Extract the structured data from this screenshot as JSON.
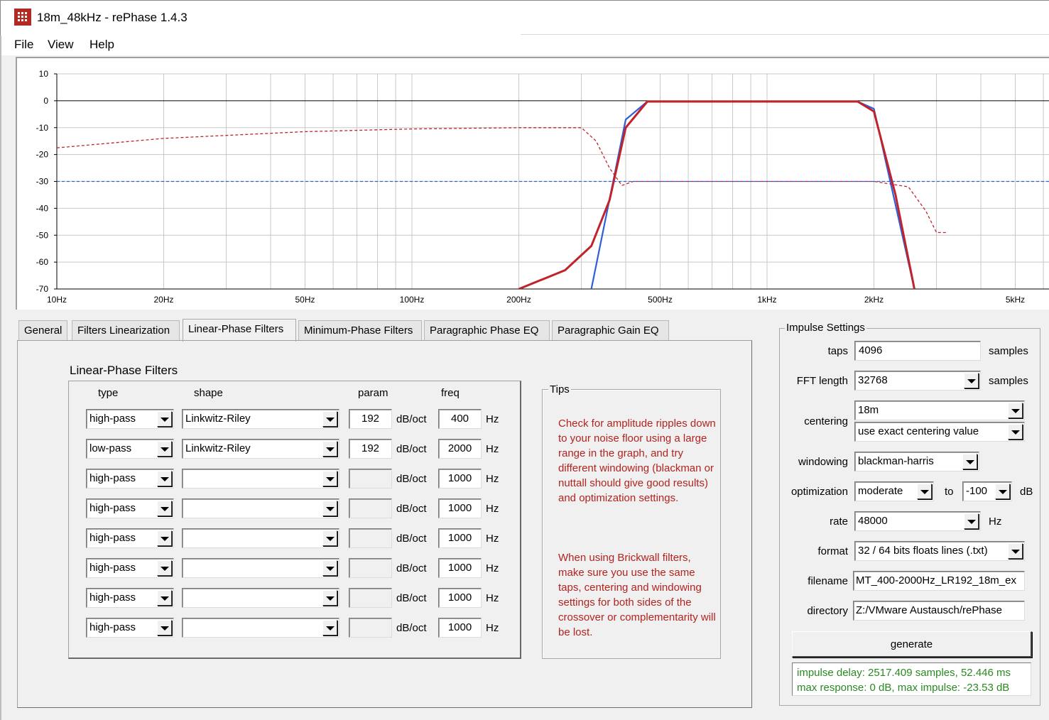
{
  "window": {
    "title": "18m_48kHz  -  rePhase 1.4.3"
  },
  "menu": [
    "File",
    "View",
    "Help"
  ],
  "graph": {
    "y_ticks": [
      "10",
      "0",
      "-10",
      "-20",
      "-30",
      "-40",
      "-50",
      "-60",
      "-70"
    ],
    "x_ticks": [
      "10Hz",
      "20Hz",
      "50Hz",
      "100Hz",
      "200Hz",
      "500Hz",
      "1kHz",
      "2kHz",
      "5kHz"
    ],
    "colors": {
      "red": "#c0242a",
      "blue": "#2f5fd8",
      "grid": "#c8c8c8"
    }
  },
  "chart_data": {
    "type": "line",
    "title": "",
    "xlabel": "",
    "ylabel": "",
    "x_scale": "log",
    "xlim": [
      10,
      7000
    ],
    "ylim": [
      -70,
      10
    ],
    "series": [
      {
        "style": "solid blue",
        "x": [
          320,
          400,
          460,
          1800,
          2000,
          2600
        ],
        "y": [
          -70,
          -7,
          -0.3,
          -0.3,
          -3,
          -70
        ]
      },
      {
        "style": "solid red",
        "x": [
          200,
          270,
          320,
          360,
          400,
          460,
          1800,
          2000,
          2300,
          2600
        ],
        "y": [
          -70,
          -63,
          -54,
          -37,
          -10,
          -0.3,
          -0.3,
          -4,
          -35,
          -70
        ]
      },
      {
        "style": "dashed red",
        "x": [
          10,
          20,
          50,
          100,
          200,
          300,
          330,
          360,
          390,
          420,
          1000,
          2000,
          2500,
          2800,
          3000,
          3200
        ],
        "y": [
          -17.5,
          -14,
          -11.5,
          -10.5,
          -10,
          -10,
          -15,
          -25,
          -31.5,
          -30,
          -30,
          -30,
          -32,
          -41,
          -49,
          -49
        ]
      },
      {
        "style": "dashed blue",
        "x": [
          10,
          7000
        ],
        "y": [
          -30,
          -30
        ]
      }
    ]
  },
  "tabs": [
    {
      "label": "General",
      "active": false
    },
    {
      "label": "Filters Linearization",
      "active": false
    },
    {
      "label": "Linear-Phase Filters",
      "active": true
    },
    {
      "label": "Minimum-Phase Filters",
      "active": false
    },
    {
      "label": "Paragraphic Phase EQ",
      "active": false
    },
    {
      "label": "Paragraphic Gain EQ",
      "active": false
    }
  ],
  "linear_phase": {
    "title": "Linear-Phase Filters",
    "headers": {
      "type": "type",
      "shape": "shape",
      "param": "param",
      "freq": "freq"
    },
    "unit_param": "dB/oct",
    "unit_freq": "Hz",
    "rows": [
      {
        "type": "high-pass",
        "shape": "Linkwitz-Riley",
        "param": "192",
        "freq": "400"
      },
      {
        "type": "low-pass",
        "shape": "Linkwitz-Riley",
        "param": "192",
        "freq": "2000"
      },
      {
        "type": "high-pass",
        "shape": "",
        "param": "",
        "freq": "1000"
      },
      {
        "type": "high-pass",
        "shape": "",
        "param": "",
        "freq": "1000"
      },
      {
        "type": "high-pass",
        "shape": "",
        "param": "",
        "freq": "1000"
      },
      {
        "type": "high-pass",
        "shape": "",
        "param": "",
        "freq": "1000"
      },
      {
        "type": "high-pass",
        "shape": "",
        "param": "",
        "freq": "1000"
      },
      {
        "type": "high-pass",
        "shape": "",
        "param": "",
        "freq": "1000"
      }
    ]
  },
  "tips": {
    "title": "Tips",
    "paragraph1": "Check for amplitude ripples down to your noise floor using a large range in the graph, and try different windowing (blackman or nuttall should give good results) and optimization settings.",
    "paragraph2": "When using Brickwall filters, make sure you use the same taps, centering and windowing settings for both sides of the crossover or complementarity will be lost."
  },
  "impulse": {
    "title": "Impulse Settings",
    "taps_label": "taps",
    "taps": "4096",
    "taps_unit": "samples",
    "fft_label": "FFT length",
    "fft": "32768",
    "fft_unit": "samples",
    "centering_label": "centering",
    "centering": "18m",
    "centering_mode": "use exact centering value",
    "windowing_label": "windowing",
    "windowing": "blackman-harris",
    "optimization_label": "optimization",
    "optimization": "moderate",
    "to_label": "to",
    "opt_db": "-100",
    "db_unit": "dB",
    "rate_label": "rate",
    "rate": "48000",
    "rate_unit": "Hz",
    "format_label": "format",
    "format": "32 / 64 bits floats lines (.txt)",
    "filename_label": "filename",
    "filename": "MT_400-2000Hz_LR192_18m_ex",
    "directory_label": "directory",
    "directory": "Z:/VMware Austausch/rePhase",
    "generate": "generate",
    "status_line1": "impulse delay: 2517.409 samples, 52.446 ms",
    "status_line2": "max response: 0 dB, max impulse: -23.53 dB"
  }
}
